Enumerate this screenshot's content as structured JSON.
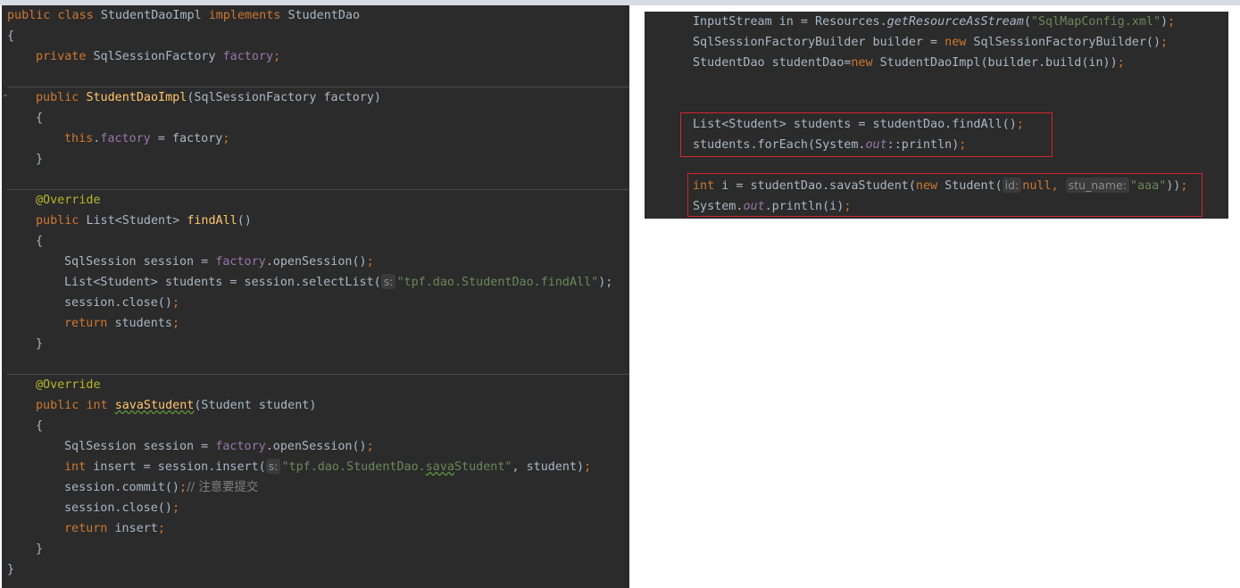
{
  "left_code": {
    "l1": [
      "public",
      "class",
      "StudentDaoImpl",
      "implements",
      "StudentDao"
    ],
    "l2": "{",
    "l3": [
      "private",
      "SqlSessionFactory",
      "factory",
      ";"
    ],
    "l4": [
      "public",
      "StudentDaoImpl",
      "(SqlSessionFactory factory)"
    ],
    "l5": "{",
    "l6": [
      "this",
      ".",
      "factory",
      " = factory",
      ";"
    ],
    "l7": "}",
    "l8": "@Override",
    "l9": [
      "public",
      "List<Student>",
      "findAll",
      "()"
    ],
    "l10": "{",
    "l11": [
      "SqlSession session = ",
      "factory",
      ".openSession()",
      ";"
    ],
    "l12": [
      "List<Student> students = session.selectList(",
      "s:",
      "\"tpf.dao.StudentDao.findAll\"",
      ");"
    ],
    "l13": [
      "session.close()",
      ";"
    ],
    "l14": [
      "return",
      "students",
      ";"
    ],
    "l15": "}",
    "l16": "@Override",
    "l17": [
      "public",
      "int",
      "savaStudent",
      "(Student student)"
    ],
    "l18": "{",
    "l19": [
      "SqlSession session = ",
      "factory",
      ".openSession()",
      ";"
    ],
    "l20": [
      "int",
      "insert = session.insert(",
      "s:",
      "\"tpf.dao.StudentDao.",
      "sava",
      "Student\"",
      ", student)",
      ";"
    ],
    "l21": [
      "session.commit()",
      ";",
      "// 注意要提交"
    ],
    "l22": [
      "session.close()",
      ";"
    ],
    "l23": [
      "return",
      "insert",
      ";"
    ],
    "l24": "}",
    "l25": "}"
  },
  "right_code": {
    "r1": [
      "InputStream in = Resources.",
      "getResourceAsStream",
      "(",
      "\"SqlMapConfig.xml\"",
      ")",
      ";"
    ],
    "r2": [
      "SqlSessionFactoryBuilder builder = ",
      "new",
      "SqlSessionFactoryBuilder()",
      ";"
    ],
    "r3": [
      "StudentDao studentDao=",
      "new",
      "StudentDaoImpl(builder.build(in))",
      ";"
    ],
    "r4": [
      "List<Student> students = studentDao.findAll()",
      ";"
    ],
    "r5": [
      "students.forEach(System.",
      "out",
      "::println)",
      ";"
    ],
    "r6": [
      "int",
      "i = studentDao.savaStudent(",
      "new",
      "Student(",
      "id:",
      "null",
      ",",
      "stu_name:",
      "\"aaa\"",
      "))",
      ";"
    ],
    "r7": [
      "System.",
      "out",
      ".println(i)",
      ";"
    ]
  },
  "colors": {
    "editor_bg": "#2b2b2b",
    "keyword": "#cc7832",
    "method_decl": "#ffc66d",
    "field": "#9876aa",
    "string": "#6a8759",
    "annotation": "#bbb529",
    "comment": "#808080",
    "highlight_box": "#d1262e"
  }
}
